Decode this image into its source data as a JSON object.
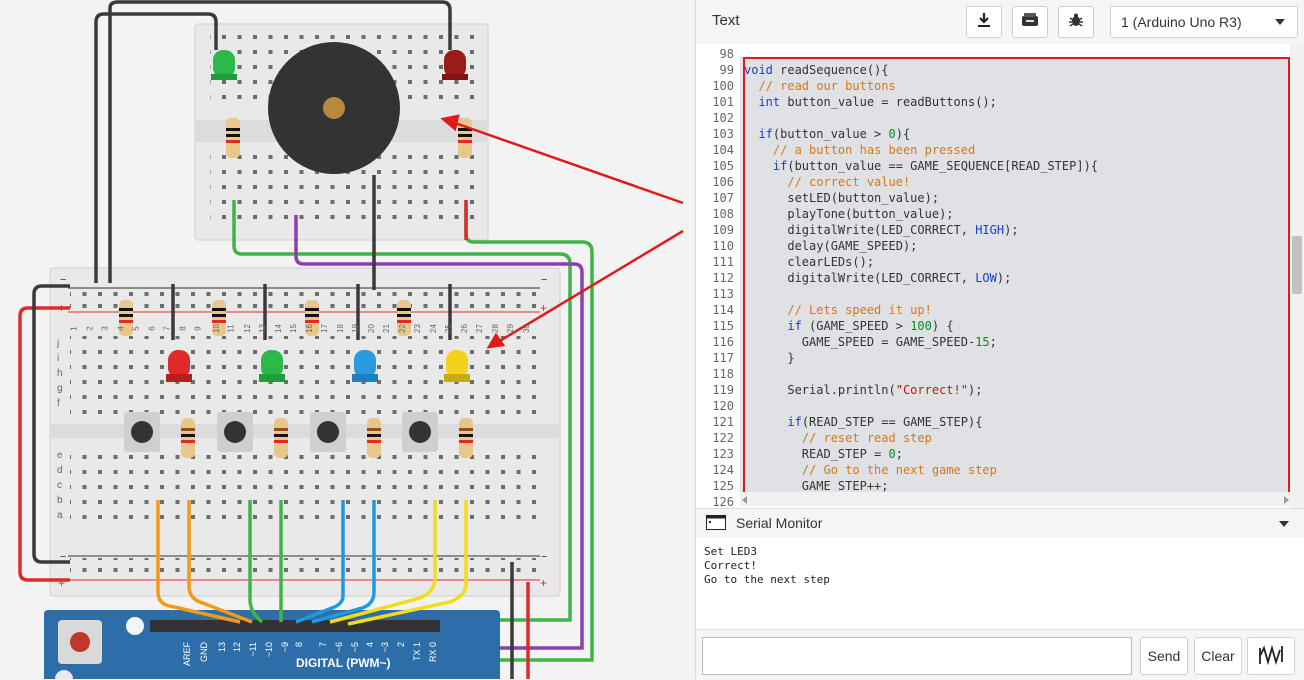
{
  "toolbar": {
    "mode_label": "Text",
    "download_icon": "download-icon",
    "library_icon": "library-icon",
    "debug_icon": "bug-icon",
    "device_select": "1 (Arduino Uno R3)"
  },
  "editor": {
    "lines": [
      {
        "n": "98",
        "t": ""
      },
      {
        "n": "99",
        "t": "void readSequence(){"
      },
      {
        "n": "100",
        "t": "  // read our buttons"
      },
      {
        "n": "101",
        "t": "  int button_value = readButtons();"
      },
      {
        "n": "102",
        "t": ""
      },
      {
        "n": "103",
        "t": "  if(button_value > 0){"
      },
      {
        "n": "104",
        "t": "    // a button has been pressed"
      },
      {
        "n": "105",
        "t": "    if(button_value == GAME_SEQUENCE[READ_STEP]){"
      },
      {
        "n": "106",
        "t": "      // correct value!"
      },
      {
        "n": "107",
        "t": "      setLED(button_value);"
      },
      {
        "n": "108",
        "t": "      playTone(button_value);"
      },
      {
        "n": "109",
        "t": "      digitalWrite(LED_CORRECT, HIGH);"
      },
      {
        "n": "110",
        "t": "      delay(GAME_SPEED);"
      },
      {
        "n": "111",
        "t": "      clearLEDs();"
      },
      {
        "n": "112",
        "t": "      digitalWrite(LED_CORRECT, LOW);"
      },
      {
        "n": "113",
        "t": ""
      },
      {
        "n": "114",
        "t": "      // Lets speed it up!"
      },
      {
        "n": "115",
        "t": "      if (GAME_SPEED > 100) {"
      },
      {
        "n": "116",
        "t": "        GAME_SPEED = GAME_SPEED-15;"
      },
      {
        "n": "117",
        "t": "      }"
      },
      {
        "n": "118",
        "t": ""
      },
      {
        "n": "119",
        "t": "      Serial.println(\"Correct!\");"
      },
      {
        "n": "120",
        "t": ""
      },
      {
        "n": "121",
        "t": "      if(READ_STEP == GAME_STEP){"
      },
      {
        "n": "122",
        "t": "        // reset read step"
      },
      {
        "n": "123",
        "t": "        READ_STEP = 0;"
      },
      {
        "n": "124",
        "t": "        // Go to the next game step"
      },
      {
        "n": "125",
        "t": "        GAME_STEP++;"
      },
      {
        "n": "126",
        "t": ""
      }
    ]
  },
  "serial": {
    "title": "Serial Monitor",
    "icon": "monitor-icon",
    "output": [
      "Set LED3",
      "Correct!",
      "Go to the next step"
    ],
    "input_value": "",
    "send_label": "Send",
    "clear_label": "Clear",
    "graph_icon": "graph-icon"
  },
  "board": {
    "pin_labels": [
      "AREF",
      "GND",
      "13",
      "12",
      "~11",
      "~10",
      "~9",
      "8",
      "7",
      "~6",
      "~5",
      "4",
      "~3",
      "2",
      "TX 1",
      "RX 0"
    ],
    "digital_label": "DIGITAL (PWM~)",
    "row_letters_top": [
      "j",
      "i",
      "h",
      "g",
      "f"
    ],
    "row_letters_bottom": [
      "e",
      "d",
      "c",
      "b",
      "a"
    ],
    "col_numbers": [
      "1",
      "2",
      "3",
      "4",
      "5",
      "6",
      "7",
      "8",
      "9",
      "10",
      "11",
      "12",
      "13",
      "14",
      "15",
      "16",
      "17",
      "18",
      "19",
      "20",
      "21",
      "22",
      "23",
      "24",
      "25",
      "26",
      "27",
      "28",
      "29",
      "30"
    ]
  },
  "colors": {
    "annotation_red": "#e01b1b",
    "led_green": "#2db84a",
    "led_red_top": "#9b1b1b",
    "led_red": "#e02a2a",
    "led_blue": "#2a9be0",
    "led_yellow": "#f2d21b",
    "wire_orange": "#f29a1b",
    "wire_green": "#3fb548",
    "wire_blue": "#1e9be0",
    "wire_yellow": "#f2dc1b",
    "wire_purple": "#8b3fb0",
    "wire_red": "#e02a2a",
    "wire_black": "#333333",
    "board_blue": "#2d6ea8"
  }
}
